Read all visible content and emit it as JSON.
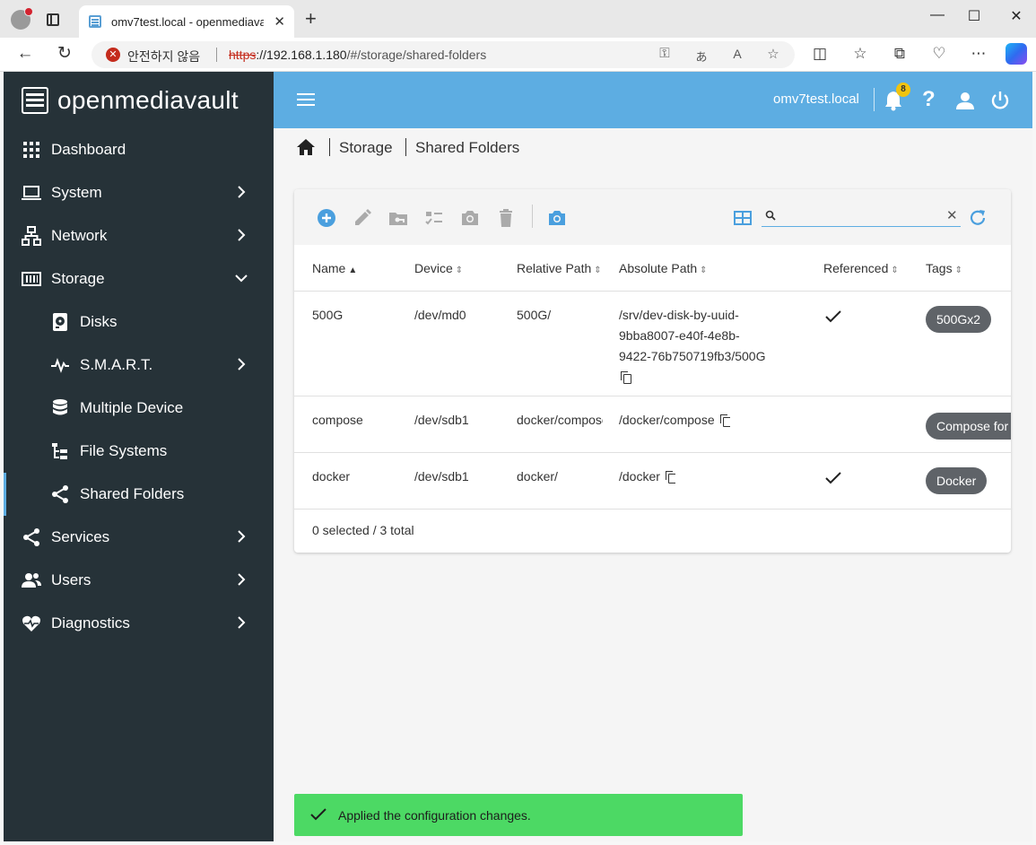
{
  "browser": {
    "tab_title": "omv7test.local - openmediavault",
    "tab_close": "✕",
    "security_text": "안전하지 않음",
    "url_scheme": "https",
    "url_host": "://192.168.1.180",
    "url_path": "/#/storage/shared-folders"
  },
  "sidebar": {
    "brand": "openmediavault",
    "items": [
      {
        "label": "Dashboard",
        "icon": "dashboard-icon"
      },
      {
        "label": "System",
        "icon": "laptop-icon"
      },
      {
        "label": "Network",
        "icon": "network-icon"
      },
      {
        "label": "Storage",
        "icon": "storage-icon"
      },
      {
        "label": "Disks",
        "icon": "disk-icon"
      },
      {
        "label": "S.M.A.R.T.",
        "icon": "pulse-icon"
      },
      {
        "label": "Multiple Device",
        "icon": "database-icon"
      },
      {
        "label": "File Systems",
        "icon": "tree-icon"
      },
      {
        "label": "Shared Folders",
        "icon": "share-icon"
      },
      {
        "label": "Services",
        "icon": "share-icon"
      },
      {
        "label": "Users",
        "icon": "users-icon"
      },
      {
        "label": "Diagnostics",
        "icon": "heart-pulse-icon"
      }
    ]
  },
  "topbar": {
    "hostname": "omv7test.local",
    "notification_count": "8",
    "help": "?"
  },
  "breadcrumb": {
    "items": [
      "Storage",
      "Shared Folders"
    ]
  },
  "table": {
    "columns": [
      "Name",
      "Device",
      "Relative Path",
      "Absolute Path",
      "Referenced",
      "Tags"
    ],
    "rows": [
      {
        "name": "500G",
        "device": "/dev/md0",
        "relative_path": "500G/",
        "absolute_path_lines": [
          "/srv/dev-disk-by-uuid-",
          "9bba8007-e40f-4e8b-",
          "9422-76b750719fb3/500G"
        ],
        "referenced": true,
        "tag": "500Gx2"
      },
      {
        "name": "compose",
        "device": "/dev/sdb1",
        "relative_path": "docker/compose/",
        "absolute_path": "/docker/compose",
        "referenced": false,
        "tag": "Compose for"
      },
      {
        "name": "docker",
        "device": "/dev/sdb1",
        "relative_path": "docker/",
        "absolute_path": "/docker",
        "referenced": true,
        "tag": "Docker"
      }
    ],
    "footer": "0 selected / 3 total"
  },
  "toast": {
    "message": "Applied the configuration changes."
  },
  "colors": {
    "sidebar_bg": "#263238",
    "topbar_bg": "#5dade2",
    "toast_bg": "#4cd964",
    "tag_bg": "#5f6368"
  }
}
